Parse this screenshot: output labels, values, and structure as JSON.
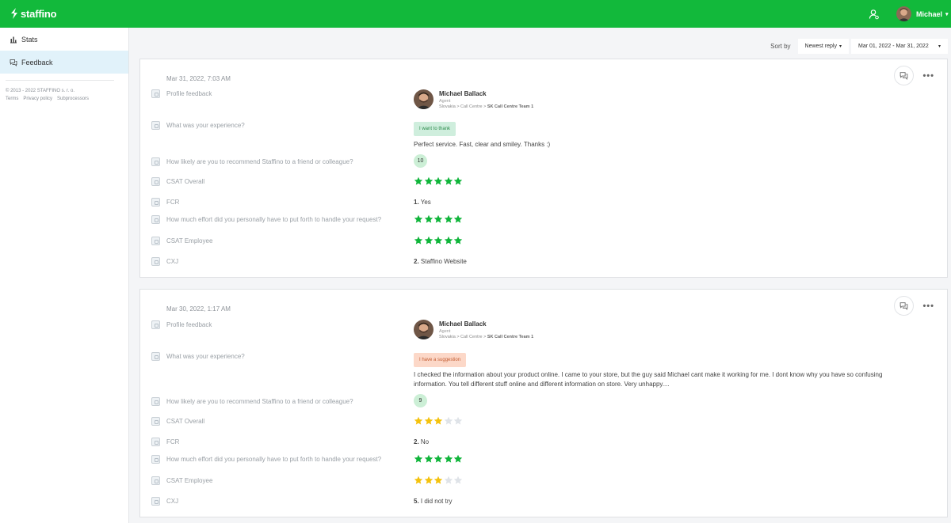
{
  "app": {
    "brand": "staffino",
    "user_name": "Michael"
  },
  "colors": {
    "brand_green": "#12b93b",
    "star_green": "#0fb53a",
    "star_yellow": "#f4c20d",
    "star_empty": "#dfe3e8"
  },
  "sidebar": {
    "items": [
      {
        "label": "Stats",
        "icon": "bar-chart-icon"
      },
      {
        "label": "Feedback",
        "icon": "chat-bubbles-icon"
      }
    ],
    "copyright": "© 2013 - 2022 STAFFINO s. r. o.",
    "links": [
      "Terms",
      "Privacy policy",
      "Subprocessors"
    ]
  },
  "sort": {
    "label": "Sort by",
    "order": "Newest reply",
    "date_range": "Mar 01, 2022 - Mar 31, 2022"
  },
  "feedback": [
    {
      "date": "Mar 31, 2022, 7:03 AM",
      "questions": {
        "profile": "Profile feedback",
        "experience": "What was your experience?",
        "recommend": "How likely are you to recommend Staffino to a friend or colleague?",
        "csat_overall": "CSAT Overall",
        "fcr": "FCR",
        "effort": "How much effort did you personally have to put forth to handle your request?",
        "csat_employee": "CSAT Employee",
        "cxj": "CXJ"
      },
      "agent": {
        "name": "Michael Ballack",
        "role": "Agent",
        "path": "Slovakia > Call Centre >",
        "team": "SK Call Centre Team 1"
      },
      "tag": "I want to thank",
      "comment": "Perfect service. Fast, clear and smiley. Thanks :)",
      "nps": "10",
      "csat_overall_stars": 5,
      "fcr": "Yes",
      "fcr_num": "1.",
      "effort_stars": 5,
      "csat_employee_stars": 5,
      "cxj": "Staffino Website",
      "cxj_num": "2."
    },
    {
      "date": "Mar 30, 2022, 1:17 AM",
      "questions": {
        "profile": "Profile feedback",
        "experience": "What was your experience?",
        "recommend": "How likely are you to recommend Staffino to a friend or colleague?",
        "csat_overall": "CSAT Overall",
        "fcr": "FCR",
        "effort": "How much effort did you personally have to put forth to handle your request?",
        "csat_employee": "CSAT Employee",
        "cxj": "CXJ"
      },
      "agent": {
        "name": "Michael Ballack",
        "role": "Agent",
        "path": "Slovakia > Call Centre >",
        "team": "SK Call Centre Team 1"
      },
      "tag": "I have a suggestion",
      "comment": "I checked the information about your product online. I came to your store, but the guy said Michael cant make it working for me. I dont know why you have so confusing information. You tell different stuff online and different information on store. Very unhappy....",
      "nps": "9",
      "csat_overall_stars": 3,
      "fcr": "No",
      "fcr_num": "2.",
      "effort_stars": 5,
      "csat_employee_stars": 3,
      "cxj": "I did not try",
      "cxj_num": "5."
    }
  ]
}
